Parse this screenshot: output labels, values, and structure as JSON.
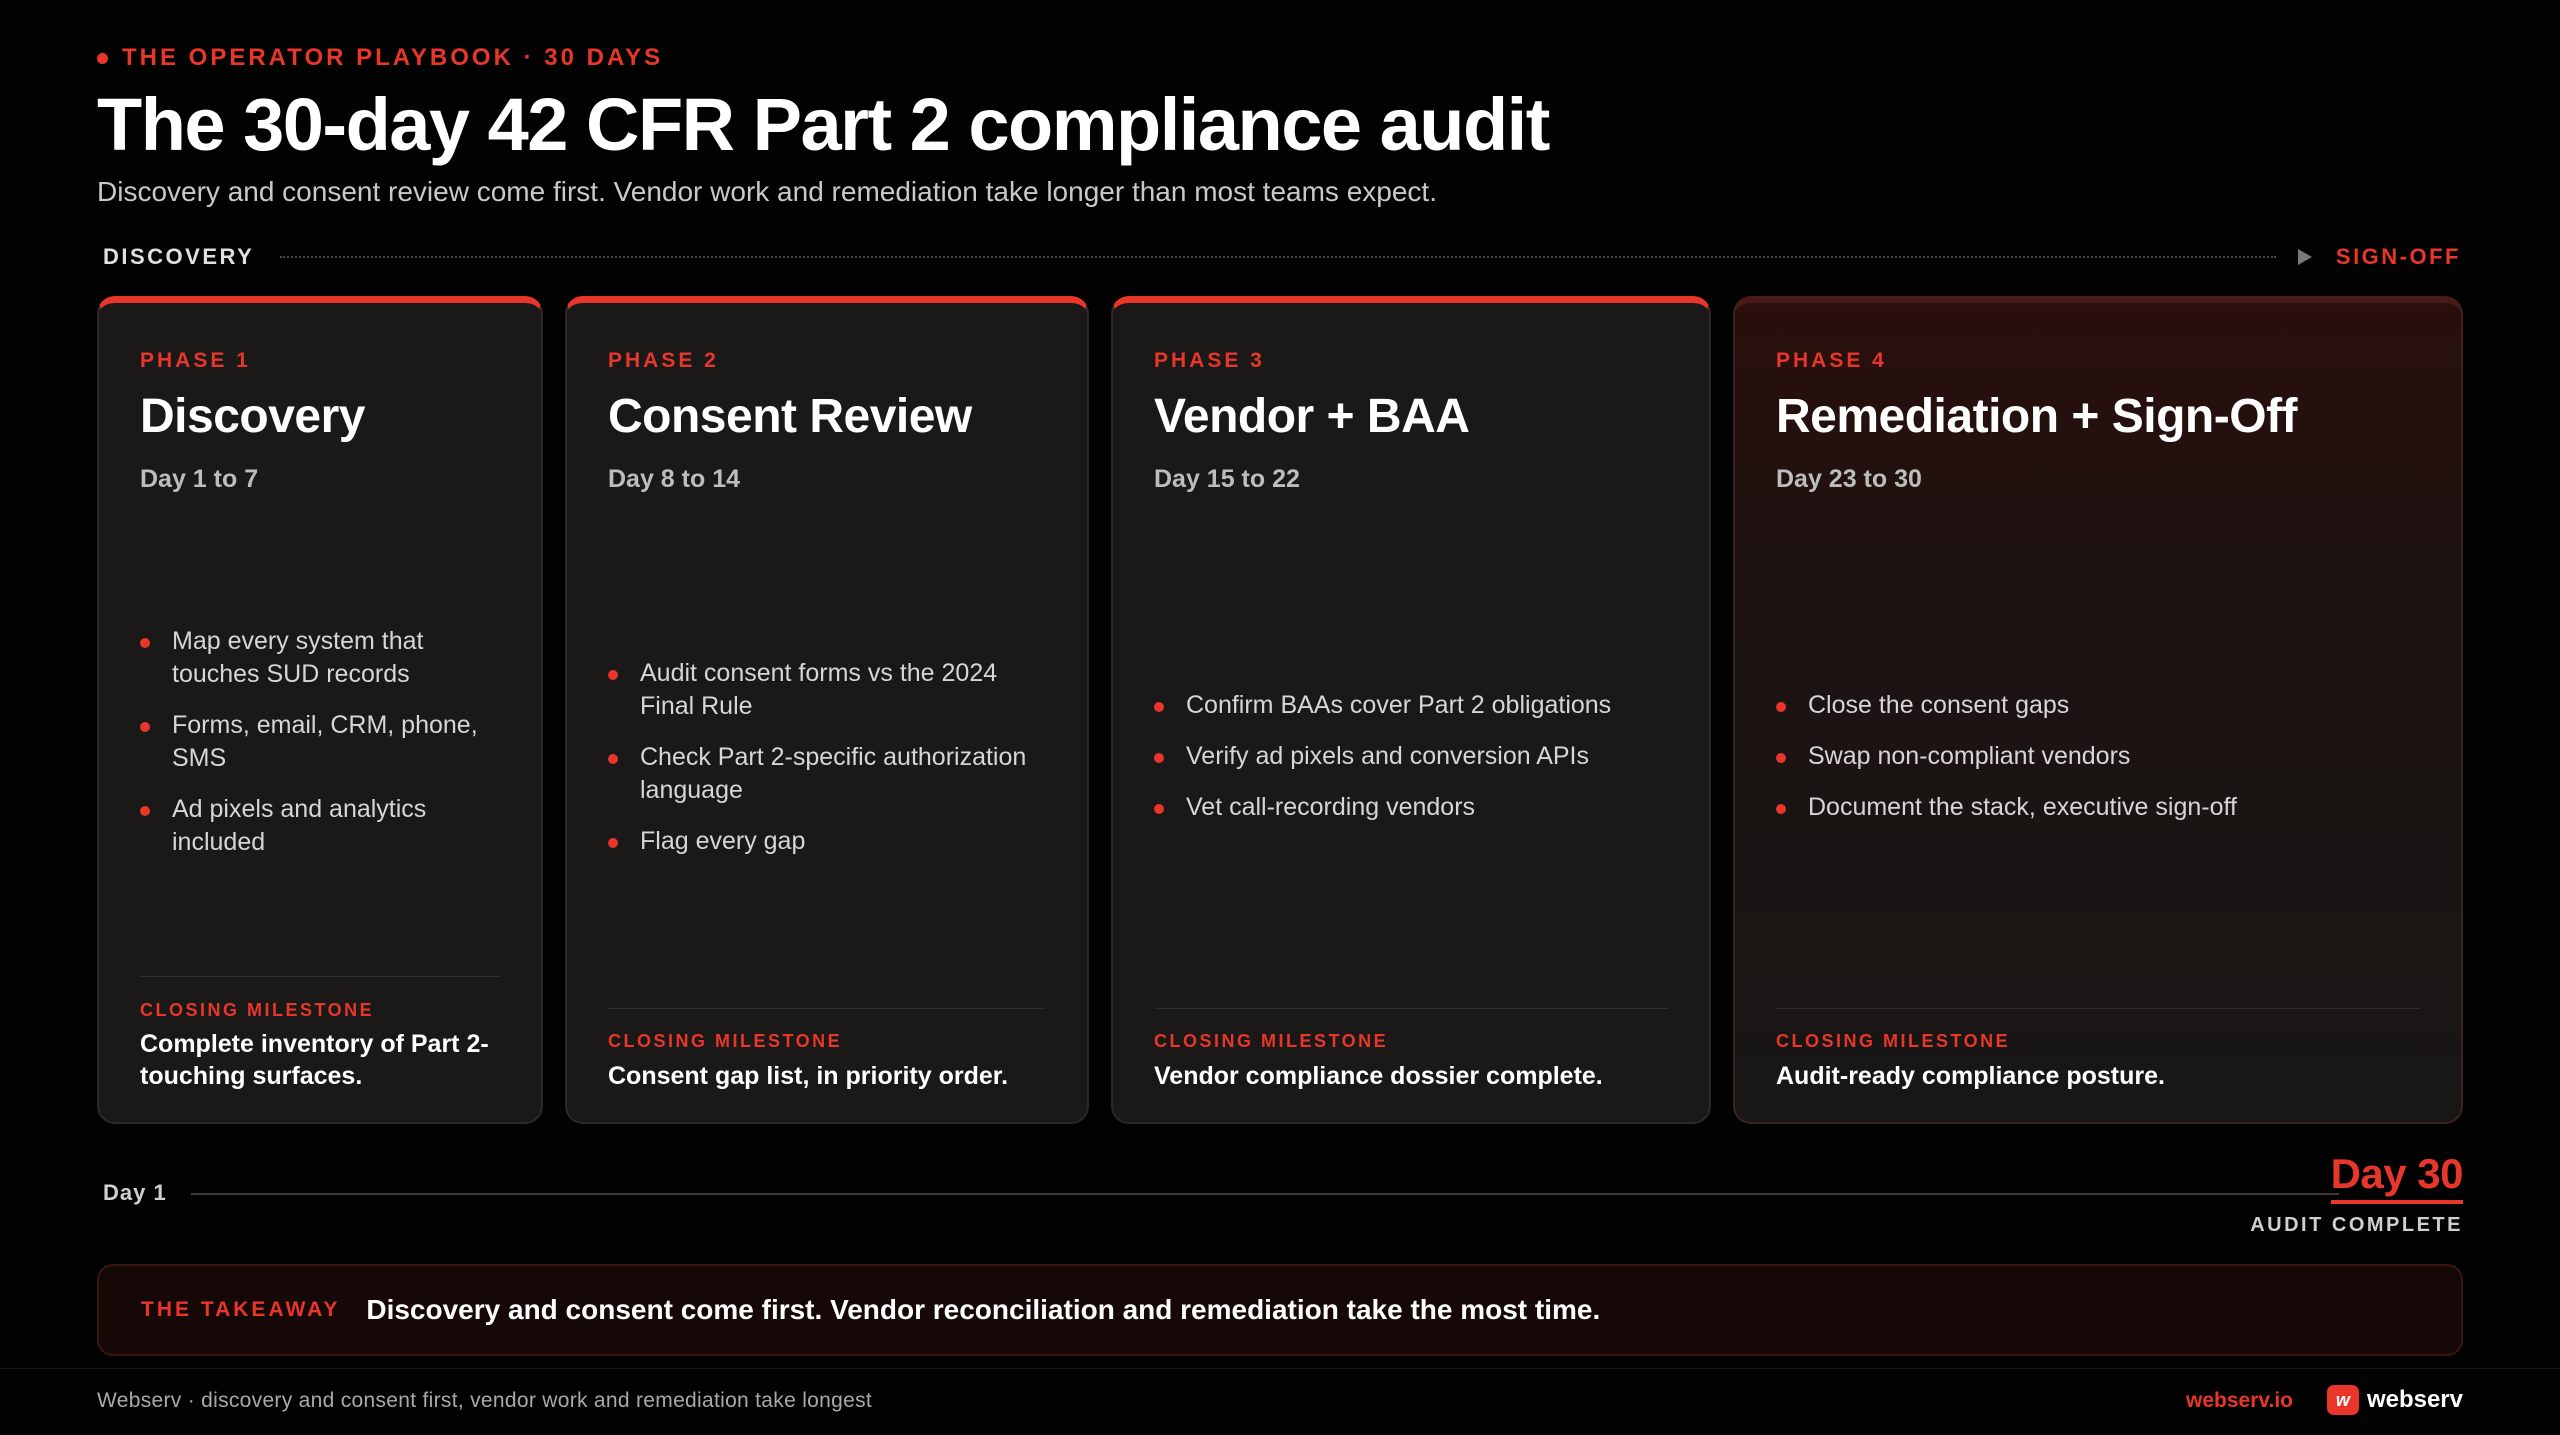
{
  "header": {
    "eyebrow": "THE OPERATOR PLAYBOOK · 30 DAYS",
    "title": "The 30-day 42 CFR Part 2 compliance audit",
    "subtitle": "Discovery and consent review come first. Vendor work and remediation take longer than most teams expect."
  },
  "flow": {
    "start": "DISCOVERY",
    "end": "SIGN-OFF"
  },
  "phases": [
    {
      "label": "PHASE 1",
      "title": "Discovery",
      "range": "Day 1 to 7",
      "bullets": [
        "Map every system that touches SUD records",
        "Forms, email, CRM, phone, SMS",
        "Ad pixels and analytics included"
      ],
      "milestone_label": "CLOSING MILESTONE",
      "milestone": "Complete inventory of Part 2-touching surfaces."
    },
    {
      "label": "PHASE 2",
      "title": "Consent Review",
      "range": "Day 8 to 14",
      "bullets": [
        "Audit consent forms vs the 2024 Final Rule",
        "Check Part 2-specific authorization language",
        "Flag every gap"
      ],
      "milestone_label": "CLOSING MILESTONE",
      "milestone": "Consent gap list, in priority order."
    },
    {
      "label": "PHASE 3",
      "title": "Vendor + BAA",
      "range": "Day 15 to 22",
      "bullets": [
        "Confirm BAAs cover Part 2 obligations",
        "Verify ad pixels and conversion APIs",
        "Vet call-recording vendors"
      ],
      "milestone_label": "CLOSING MILESTONE",
      "milestone": "Vendor compliance dossier complete."
    },
    {
      "label": "PHASE 4",
      "title": "Remediation + Sign-Off",
      "range": "Day 23 to 30",
      "bullets": [
        "Close the consent gaps",
        "Swap non-compliant vendors",
        "Document the stack, executive sign-off"
      ],
      "milestone_label": "CLOSING MILESTONE",
      "milestone": "Audit-ready compliance posture."
    }
  ],
  "timeline": {
    "start": "Day 1",
    "end": "Day 30",
    "end_caption": "AUDIT COMPLETE"
  },
  "takeaway": {
    "label": "THE TAKEAWAY",
    "text": "Discovery and consent come first. Vendor reconciliation and remediation take the most time."
  },
  "footer": {
    "left": "Webserv · discovery and consent first, vendor work and remediation take longest",
    "url": "webserv.io",
    "brand_mark": "w",
    "brand_name": "webserv"
  },
  "colors": {
    "accent": "#e8362a",
    "background": "#020202",
    "card": "#1a1918"
  }
}
